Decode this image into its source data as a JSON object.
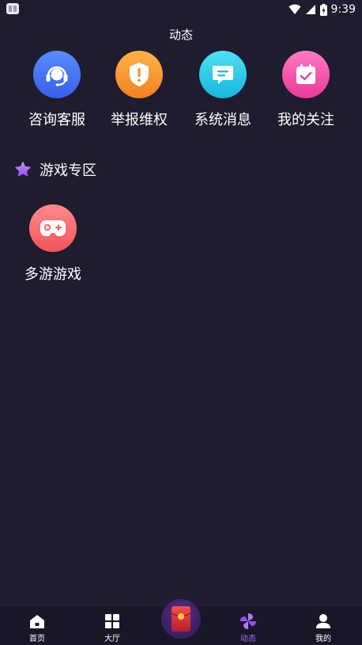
{
  "status_bar": {
    "time": "9:39"
  },
  "header": {
    "title": "动态"
  },
  "quick_actions": [
    {
      "label": "咨询客服",
      "icon": "headset-icon",
      "color": "#3f6ef0"
    },
    {
      "label": "举报维权",
      "icon": "shield-alert-icon",
      "color": "#f98a2a"
    },
    {
      "label": "系统消息",
      "icon": "message-icon",
      "color": "#1ec6e6"
    },
    {
      "label": "我的关注",
      "icon": "calendar-check-icon",
      "color": "#f04aa8"
    }
  ],
  "game_section": {
    "title": "游戏专区",
    "icon": "star-icon",
    "games": [
      {
        "label": "多游游戏",
        "icon": "gamepad-icon"
      }
    ]
  },
  "bottom_nav": {
    "items": [
      {
        "label": "首页",
        "icon": "home-icon"
      },
      {
        "label": "大厅",
        "icon": "grid-icon"
      },
      {
        "label": "动态",
        "icon": "pinwheel-icon",
        "active": true
      },
      {
        "label": "我的",
        "icon": "user-icon"
      }
    ],
    "center_icon": "red-envelope-icon",
    "active_color": "#a86bff"
  }
}
